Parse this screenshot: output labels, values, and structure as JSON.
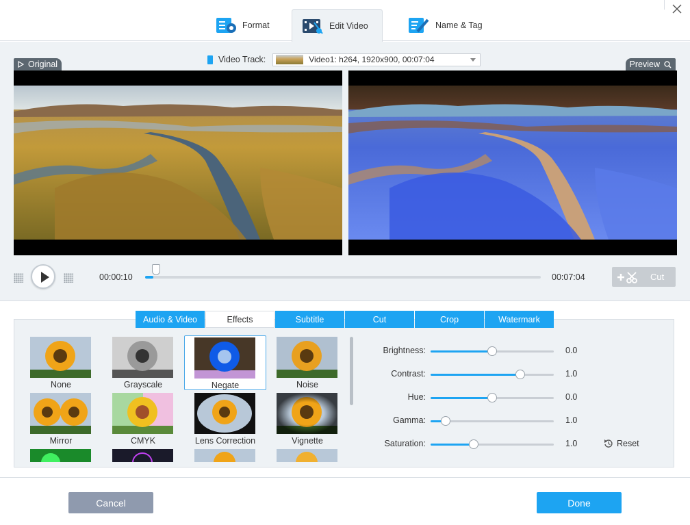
{
  "tabs": {
    "format": "Format",
    "edit_video": "Edit Video",
    "name_tag": "Name & Tag"
  },
  "video_track": {
    "label": "Video Track:",
    "selected": "Video1: h264, 1920x900, 00:07:04"
  },
  "badges": {
    "original": "Original",
    "preview": "Preview"
  },
  "player": {
    "current_time": "00:00:10",
    "total_time": "00:07:04",
    "progress": 0.02,
    "cut_label": "Cut"
  },
  "edit_tabs": [
    "Audio & Video",
    "Effects",
    "Subtitle",
    "Cut",
    "Crop",
    "Watermark"
  ],
  "active_edit_tab": "Effects",
  "effects": [
    {
      "label": "None"
    },
    {
      "label": "Grayscale"
    },
    {
      "label": "Negate",
      "selected": true
    },
    {
      "label": "Noise"
    },
    {
      "label": "Mirror"
    },
    {
      "label": "CMYK"
    },
    {
      "label": "Lens Correction"
    },
    {
      "label": "Vignette"
    }
  ],
  "adjustments": [
    {
      "label": "Brightness:",
      "value": "0.0",
      "level": 0.5
    },
    {
      "label": "Contrast:",
      "value": "1.0",
      "level": 0.73
    },
    {
      "label": "Hue:",
      "value": "0.0",
      "level": 0.5
    },
    {
      "label": "Gamma:",
      "value": "1.0",
      "level": 0.12
    },
    {
      "label": "Saturation:",
      "value": "1.0",
      "level": 0.35
    }
  ],
  "reset_label": "Reset",
  "footer": {
    "cancel": "Cancel",
    "done": "Done"
  },
  "colors": {
    "accent": "#1da4f2",
    "panel_bg": "#eef2f5",
    "badge_bg": "#5c6770",
    "cancel_bg": "#8f9aae"
  }
}
